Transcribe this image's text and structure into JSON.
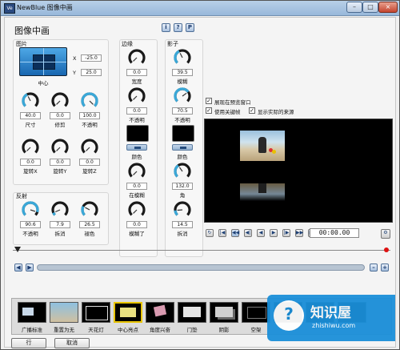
{
  "window": {
    "title": "NewBlue 图像中画",
    "close": "×",
    "minimize": "–",
    "maximize": "□",
    "icon": "Ve"
  },
  "header": {
    "title": "图像中画",
    "info_label": "i",
    "help_label": "?",
    "preset_label": "P"
  },
  "picture": {
    "group_label": "图片",
    "position_label": "中心",
    "x_label": "X",
    "x_value": "-25.0",
    "y_label": "Y",
    "y_value": "25.0",
    "knobs": [
      {
        "value": "40.0",
        "label": "尺寸",
        "level": 0.4
      },
      {
        "value": "0.0",
        "label": "修剪",
        "level": 0.0
      },
      {
        "value": "100.0",
        "label": "不透明",
        "level": 1.0
      },
      {
        "value": "0.0",
        "label": "旋转X",
        "level": 0.0
      },
      {
        "value": "0.0",
        "label": "旋转Y",
        "level": 0.0
      },
      {
        "value": "0.0",
        "label": "旋转Z",
        "level": 0.0
      }
    ]
  },
  "reflection": {
    "group_label": "反射",
    "knobs": [
      {
        "value": "90.6",
        "label": "不透明",
        "level": 0.9
      },
      {
        "value": "7.9",
        "label": "拆消",
        "level": 0.08
      },
      {
        "value": "26.5",
        "label": "褪色",
        "level": 0.27
      }
    ]
  },
  "border": {
    "group_label": "边缘",
    "width": {
      "value": "0.0",
      "label": "宽度",
      "level": 0.0
    },
    "opacity": {
      "value": "0.0",
      "label": "不透明",
      "level": 0.0
    },
    "color_label": "颜色",
    "feather_in": {
      "value": "0.0",
      "label": "在模糊",
      "level": 0.0
    },
    "feather_out": {
      "value": "0.0",
      "label": "模糊了",
      "level": 0.0
    }
  },
  "shadow": {
    "group_label": "影子",
    "blur": {
      "value": "39.5",
      "label": "模糊",
      "level": 0.4
    },
    "opacity": {
      "value": "70.5",
      "label": "不透明",
      "level": 0.7
    },
    "color_label": "颜色",
    "angle": {
      "value": "132.0",
      "label": "角",
      "level": 0.37
    },
    "falloff": {
      "value": "14.5",
      "label": "拆消",
      "level": 0.15
    }
  },
  "options": {
    "show_preview": "展现在预览窗口",
    "use_keyframes": "使用关键帧",
    "show_source": "显示实际的来源"
  },
  "transport": {
    "timecode": "00:00.00",
    "buttons": [
      "↻",
      "|◀",
      "◀◀",
      "◀|",
      "◀",
      "▶",
      "|▶",
      "▶▶",
      "▶|"
    ]
  },
  "timeline": {
    "playhead_label": "0"
  },
  "presets": {
    "items": [
      "广播标准",
      "重置为无",
      "天花灯",
      "中心亮点",
      "角度兴奋",
      "门垫",
      "阴影",
      "空架"
    ],
    "scroll_left": "◀",
    "scroll_right": "▶"
  },
  "footer": {
    "ok_label": "行",
    "cancel_label": "取消"
  },
  "watermark": {
    "text": "知识屋",
    "subtext": "zhishiwu.com"
  },
  "colors": {
    "accent": "#2e8ed6",
    "knob_arc": "#3aa8d8",
    "titlebar": "#a8c4e2"
  }
}
